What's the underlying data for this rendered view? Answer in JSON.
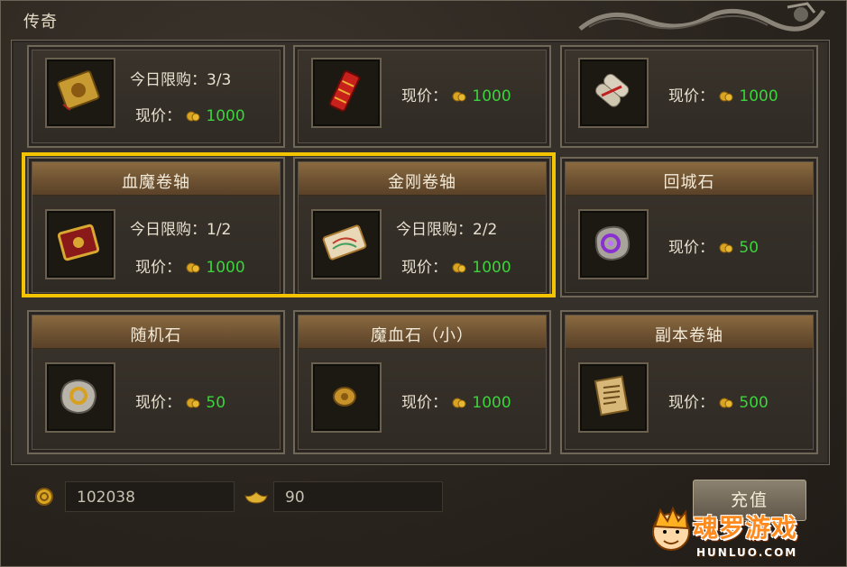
{
  "window": {
    "title": "传奇"
  },
  "labels": {
    "limit_prefix": "今日限购：",
    "price_prefix": "现价："
  },
  "items": [
    {
      "name": "",
      "limit": "3/3",
      "price": "1000",
      "icon": "golden-talisman-icon"
    },
    {
      "name": "",
      "limit": "",
      "price": "1000",
      "icon": "firecracker-icon"
    },
    {
      "name": "",
      "limit": "",
      "price": "1000",
      "icon": "tied-scroll-icon"
    },
    {
      "name": "血魔卷轴",
      "limit": "1/2",
      "price": "1000",
      "icon": "blood-demon-scroll-icon"
    },
    {
      "name": "金刚卷轴",
      "limit": "2/2",
      "price": "1000",
      "icon": "diamond-scroll-icon"
    },
    {
      "name": "回城石",
      "limit": "",
      "price": "50",
      "icon": "purple-town-stone-icon"
    },
    {
      "name": "随机石",
      "limit": "",
      "price": "50",
      "icon": "random-stone-icon"
    },
    {
      "name": "魔血石（小）",
      "limit": "",
      "price": "1000",
      "icon": "small-mana-blood-stone-icon"
    },
    {
      "name": "副本卷轴",
      "limit": "",
      "price": "500",
      "icon": "dungeon-scroll-icon"
    }
  ],
  "currency": {
    "gold_coins": "102038",
    "ingots": "90"
  },
  "buttons": {
    "recharge": "充值"
  },
  "watermark": {
    "text": "魂罗游戏",
    "sub": "HUNLUO.COM"
  },
  "colors": {
    "price_green": "#3ad53a",
    "highlight": "#f5c400",
    "header_brown": "#6e5232"
  }
}
